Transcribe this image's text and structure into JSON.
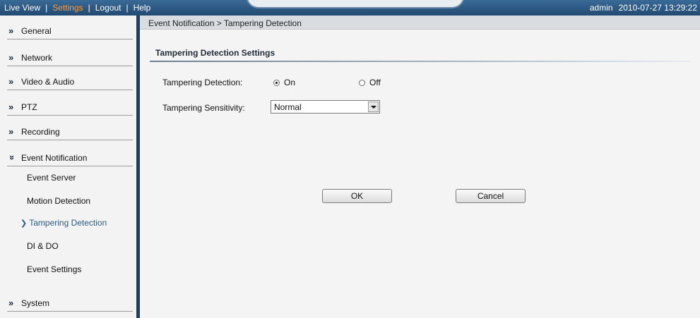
{
  "topbar": {
    "nav": [
      "Live View",
      "Settings",
      "Logout",
      "Help"
    ],
    "user": "admin",
    "datetime": "2010-07-27  13:29:22"
  },
  "sidebar": {
    "general": "General",
    "network": "Network",
    "video_audio": "Video & Audio",
    "ptz": "PTZ",
    "recording": "Recording",
    "event_notification": "Event Notification",
    "event_items": [
      "Event Server",
      "Motion Detection",
      "Tampering Detection",
      "DI & DO",
      "Event Settings"
    ],
    "system": "System"
  },
  "main": {
    "breadcrumb": "Event Notification > Tampering Detection",
    "section_title": "Tampering Detection Settings",
    "tampering_detection_label": "Tampering Detection:",
    "option_on": "On",
    "option_off": "Off",
    "selected_option": "On",
    "sensitivity_label": "Tampering Sensitivity:",
    "sensitivity_value": "Normal",
    "ok_label": "OK",
    "cancel_label": "Cancel"
  },
  "icons": {
    "collapsed_chevron": "double-chevron-right-icon",
    "expanded_chevron": "double-chevron-down-icon",
    "current_arrow": "chevron-right-icon",
    "dropdown": "chevron-down-icon"
  },
  "colors": {
    "topbar": "#2d5680",
    "active_nav": "#ff9a3c",
    "current_item": "#2c5a86",
    "sidebar_border": "#1d3f63"
  }
}
